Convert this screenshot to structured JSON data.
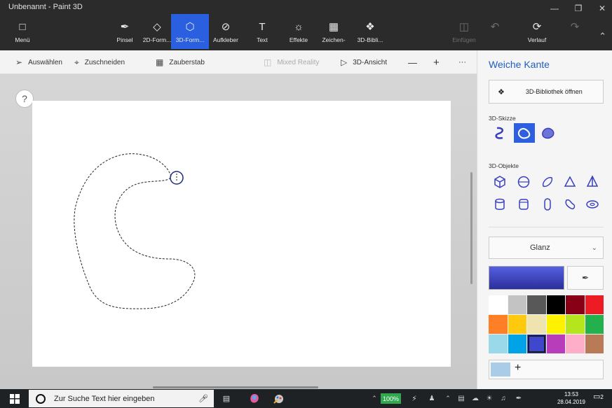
{
  "window": {
    "title": "Unbenannt - Paint 3D",
    "controls": [
      "minimize",
      "maximize",
      "close"
    ]
  },
  "ribbon": {
    "menu_label": "Menü",
    "tools": [
      {
        "label": "Pinsel",
        "icon": "brush-icon"
      },
      {
        "label": "2D-Form...",
        "icon": "2d-shapes-icon"
      },
      {
        "label": "3D-Form...",
        "icon": "3d-shapes-icon",
        "active": true
      },
      {
        "label": "Aufkleber",
        "icon": "stickers-icon"
      },
      {
        "label": "Text",
        "icon": "text-icon"
      },
      {
        "label": "Effekte",
        "icon": "effects-icon"
      },
      {
        "label": "Zeichen-",
        "icon": "canvas-icon"
      },
      {
        "label": "3D-Bibli...",
        "icon": "3d-library-icon"
      }
    ],
    "paste_label": "Einfügen",
    "history_label": "Verlauf"
  },
  "subtoolbar": {
    "select_label": "Auswählen",
    "crop_label": "Zuschneiden",
    "magic_label": "Zauberstab",
    "mixed_reality_label": "Mixed Reality",
    "view3d_label": "3D-Ansicht",
    "zoom_out": "—",
    "zoom_in": "+",
    "more": "···"
  },
  "canvas": {
    "help_label": "?"
  },
  "panel": {
    "title": "Weiche Kante",
    "library_button": "3D-Bibliothek öffnen",
    "sketch_label": "3D-Skizze",
    "objects_label": "3D-Objekte",
    "finish_label": "Glanz",
    "current_color": "#3f47c9",
    "palette": [
      "#ffffff",
      "#c3c3c3",
      "#585858",
      "#000000",
      "#880015",
      "#ed1c24",
      "#ff7f27",
      "#ffc90e",
      "#efe4b0",
      "#fff200",
      "#b5e61d",
      "#22b14c",
      "#99d9ea",
      "#00a2e8",
      "#3f48cc",
      "#b83dba",
      "#ffaec9",
      "#b97a57"
    ],
    "selected_index": 14,
    "custom_color": "#a9cde6",
    "add_color": "+"
  },
  "taskbar": {
    "search_placeholder": "Zur Suche Text hier eingeben",
    "battery": "100%",
    "time": "13:53",
    "date": "28.04.2019",
    "notifications": "2"
  }
}
